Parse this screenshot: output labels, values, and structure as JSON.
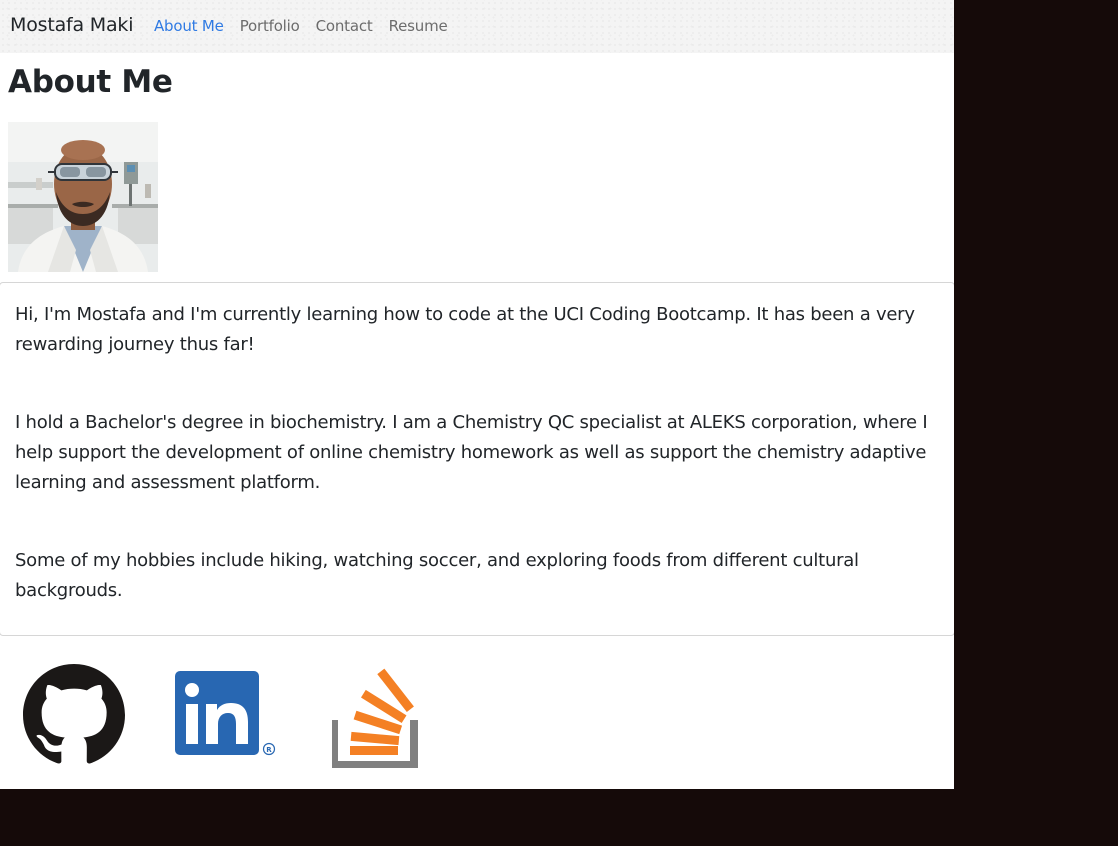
{
  "navbar": {
    "brand": "Mostafa Maki",
    "links": [
      {
        "label": "About Me",
        "active": true
      },
      {
        "label": "Portfolio",
        "active": false
      },
      {
        "label": "Contact",
        "active": false
      },
      {
        "label": "Resume",
        "active": false
      }
    ]
  },
  "main": {
    "title": "About Me",
    "paragraphs": [
      "Hi, I'm Mostafa and I'm currently learning how to code at the UCI Coding Bootcamp. It has been a very rewarding journey thus far!",
      "I hold a Bachelor's degree in biochemistry. I am a Chemistry QC specialist at ALEKS corporation, where I help support the development of online chemistry homework as well as support the chemistry adaptive learning and assessment platform.",
      "Some of my hobbies include hiking, watching soccer, and exploring foods from different cultural backgrouds."
    ]
  },
  "social": {
    "icons": [
      "github-icon",
      "linkedin-icon",
      "stackoverflow-icon"
    ],
    "linkedin_text": "in",
    "registered_mark": "®"
  },
  "colors": {
    "nav_active": "#2f7ae3",
    "linkedin_blue": "#2867b2",
    "stackoverflow_orange": "#f48024",
    "stackoverflow_gray": "#808080",
    "outer_background": "#150a09"
  }
}
